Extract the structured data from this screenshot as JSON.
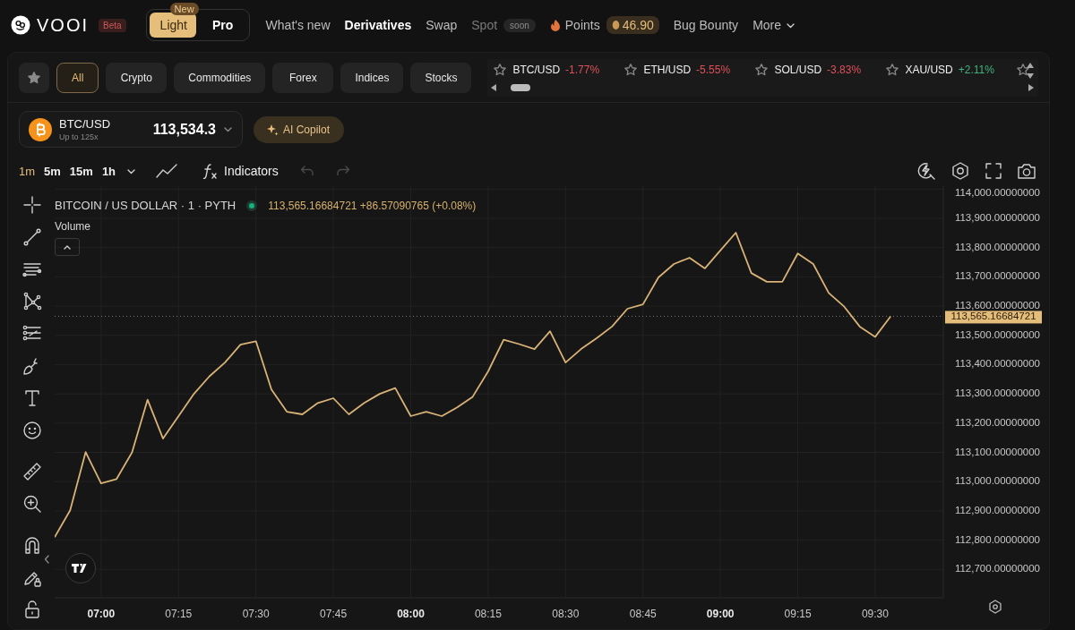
{
  "header": {
    "brand": "VOOI",
    "brand_badge": "Beta",
    "modes": [
      {
        "label": "Light",
        "selected": true,
        "badge": "New"
      },
      {
        "label": "Pro",
        "selected": false
      }
    ],
    "nav": [
      {
        "label": "What's new",
        "selected": false,
        "disabled": false
      },
      {
        "label": "Derivatives",
        "selected": true,
        "disabled": false
      },
      {
        "label": "Swap",
        "selected": false,
        "disabled": false
      },
      {
        "label": "Spot",
        "selected": false,
        "disabled": true,
        "badge": "soon"
      },
      {
        "label": "Points",
        "selected": false,
        "disabled": false,
        "kind": "points",
        "value": "46.90"
      },
      {
        "label": "Bug Bounty",
        "selected": false,
        "disabled": false
      },
      {
        "label": "More",
        "selected": false,
        "disabled": false,
        "kind": "menu"
      }
    ]
  },
  "categories": [
    {
      "label": "All",
      "selected": true
    },
    {
      "label": "Crypto",
      "selected": false
    },
    {
      "label": "Commodities",
      "selected": false
    },
    {
      "label": "Forex",
      "selected": false
    },
    {
      "label": "Indices",
      "selected": false
    },
    {
      "label": "Stocks",
      "selected": false
    }
  ],
  "tickers": [
    {
      "symbol": "BTC/USD",
      "change": "-1.77%",
      "color": "#e0505a"
    },
    {
      "symbol": "ETH/USD",
      "change": "-5.55%",
      "color": "#e0505a"
    },
    {
      "symbol": "SOL/USD",
      "change": "-3.83%",
      "color": "#e0505a"
    },
    {
      "symbol": "XAU/USD",
      "change": "+2.11%",
      "color": "#3fb27f"
    }
  ],
  "market": {
    "symbol": "BTC/USD",
    "leverage": "Up to 125x",
    "price": "113,534.3",
    "copilot": "AI Copilot"
  },
  "toolbar": {
    "timeframes": [
      {
        "label": "1m",
        "selected": true
      },
      {
        "label": "5m",
        "selected": false
      },
      {
        "label": "15m",
        "selected": false
      },
      {
        "label": "1h",
        "selected": false
      }
    ],
    "indicators": "Indicators"
  },
  "chart": {
    "title": "BITCOIN / US DOLLAR · 1 · PYTH",
    "live": true,
    "quote": "113,565.16684721 +86.57090765 (+0.08%)",
    "pane_label": "Volume",
    "price_tag": "113,565.16684721",
    "chart_data": {
      "type": "line",
      "categories": [
        null,
        null,
        null,
        "07:00",
        null,
        null,
        null,
        null,
        "07:15",
        null,
        null,
        null,
        null,
        "07:30",
        null,
        null,
        null,
        null,
        "07:45",
        null,
        null,
        null,
        null,
        "08:00",
        null,
        null,
        null,
        null,
        "08:15",
        null,
        null,
        null,
        null,
        "08:30",
        null,
        null,
        null,
        null,
        "08:45",
        null,
        null,
        null,
        null,
        "09:00",
        null,
        null,
        null,
        null,
        "09:15",
        null,
        null,
        null,
        null,
        "09:30",
        null
      ],
      "series": [
        {
          "color": "#d9b277",
          "values": [
            112810,
            112902,
            113101,
            112994,
            113009,
            113100,
            113280,
            113147,
            113224,
            113300,
            113360,
            113407,
            113468,
            113480,
            113315,
            113239,
            113230,
            113269,
            113285,
            113230,
            113269,
            113300,
            113320,
            113224,
            113239,
            113224,
            113254,
            113290,
            113377,
            113485,
            113470,
            113453,
            113514,
            113407,
            113453,
            113490,
            113530,
            113591,
            113606,
            113698,
            113744,
            113765,
            113729,
            113790,
            113851,
            113713,
            113683,
            113683,
            113780,
            113744,
            113645,
            113598,
            113530,
            113495,
            113565
          ]
        }
      ],
      "ylim": [
        112603,
        114010
      ],
      "grid": true,
      "ref_lines": [
        {
          "axis": "y",
          "value": 113565.16684721,
          "color": "#777777"
        }
      ],
      "yticks": [
        {
          "value": 112700,
          "label": "112,700.00000000"
        },
        {
          "value": 112800,
          "label": "112,800.00000000"
        },
        {
          "value": 112900,
          "label": "112,900.00000000"
        },
        {
          "value": 113000,
          "label": "113,000.00000000"
        },
        {
          "value": 113100,
          "label": "113,100.00000000"
        },
        {
          "value": 113200,
          "label": "113,200.00000000"
        },
        {
          "value": 113300,
          "label": "113,300.00000000"
        },
        {
          "value": 113400,
          "label": "113,400.00000000"
        },
        {
          "value": 113500,
          "label": "113,500.00000000"
        },
        {
          "value": 113600,
          "label": "113,600.00000000"
        },
        {
          "value": 113700,
          "label": "113,700.00000000"
        },
        {
          "value": 113800,
          "label": "113,800.00000000"
        },
        {
          "value": 113900,
          "label": "113,900.00000000"
        },
        {
          "value": 114000,
          "label": "114,000.00000000"
        }
      ]
    }
  }
}
